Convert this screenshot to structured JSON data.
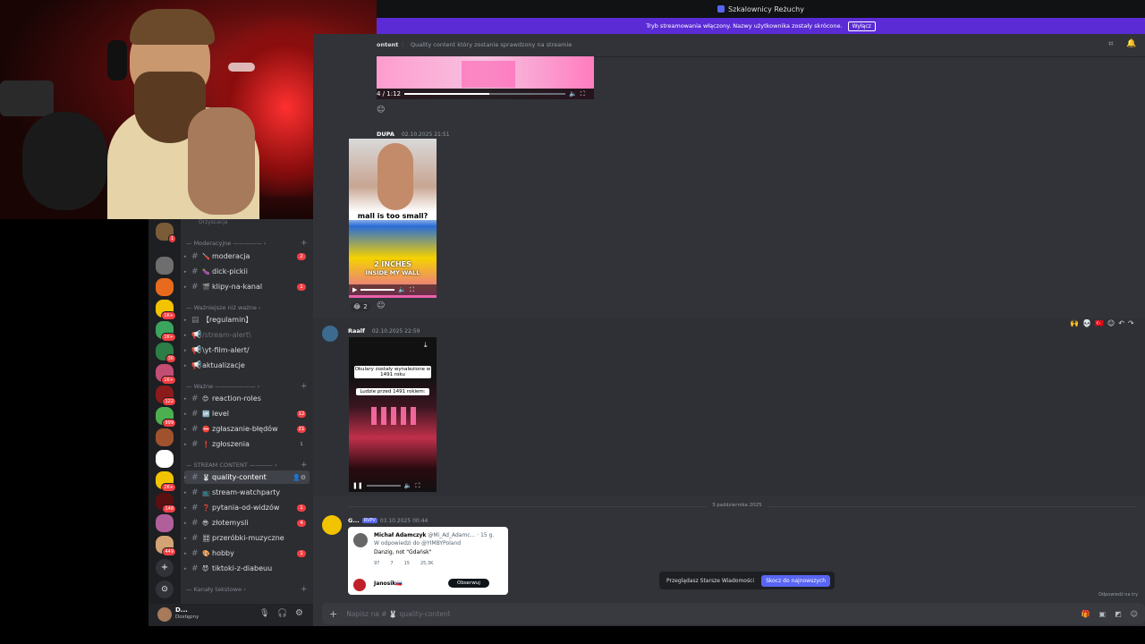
{
  "window": {
    "title": "Szkalownicy Reżuchy"
  },
  "banner": {
    "text": "Tryb streamowania włączony. Nazwy użytkownika zostały skrócone.",
    "button": "Wyłącz"
  },
  "chathead": {
    "channel_partial": "ontent",
    "topic": "Quality content który zostanie sprawdzony na streamie"
  },
  "sidebar": {
    "hidden_top_label": "Drzyscacja",
    "categories": [
      {
        "label": "Moderacyjne"
      },
      {
        "label": "Ważniejsze niż ważne"
      },
      {
        "label": "Ważne"
      },
      {
        "label": "STREAM CONTENT"
      },
      {
        "label": "Kanały tekstowe"
      }
    ],
    "channels": [
      {
        "name": "moderacja",
        "emoji": "🪛",
        "badge": "2"
      },
      {
        "name": "dick-pickii",
        "emoji": "🍆",
        "badge": ""
      },
      {
        "name": "klipy-na-kanal",
        "emoji": "🎬",
        "badge": "1"
      },
      {
        "name": "【regulamin】",
        "emoji": "",
        "badge": ""
      },
      {
        "name": "/stream-alert\\",
        "emoji": "",
        "badge": ""
      },
      {
        "name": "\\yt-film-alert/",
        "emoji": "",
        "badge": ""
      },
      {
        "name": "aktualizacje",
        "emoji": "",
        "badge": ""
      },
      {
        "name": "reaction-roles",
        "emoji": "😊",
        "badge": ""
      },
      {
        "name": "level",
        "emoji": "🆙",
        "badge": "12"
      },
      {
        "name": "zgłaszanie-błędów",
        "emoji": "⛔",
        "badge": "21"
      },
      {
        "name": "zgłoszenia",
        "emoji": "❗",
        "badge": "1"
      },
      {
        "name": "quality-content",
        "emoji": "🐰",
        "badge": ""
      },
      {
        "name": "stream-watchparty",
        "emoji": "📺",
        "badge": ""
      },
      {
        "name": "pytania-od-widzów",
        "emoji": "❓",
        "badge": "1"
      },
      {
        "name": "złotemysli",
        "emoji": "😎",
        "badge": "4"
      },
      {
        "name": "przeróbki-muzyczne",
        "emoji": "🎛",
        "badge": ""
      },
      {
        "name": "hobby",
        "emoji": "🎨",
        "badge": "1"
      },
      {
        "name": "tiktoki-z-diabeuu",
        "emoji": "😈",
        "badge": ""
      }
    ],
    "server_badges": [
      "1",
      "1",
      "1K+",
      "1K+",
      "36",
      "1K+",
      "122",
      "999",
      "2K+",
      "148",
      "449"
    ]
  },
  "user": {
    "name": "D...",
    "status": "Dostępny"
  },
  "messages": [
    {
      "video_time": "4 / 1:12"
    },
    {
      "author": "DUPA",
      "time": "02.10.2025 21:51",
      "video_caption1": "mall is too small?",
      "video_caption2": "2 INCHES",
      "video_caption3": "INSIDE MY WALL",
      "reaction_count": "2"
    },
    {
      "author": "Raalf",
      "time": "02.10.2025 22:59",
      "caption1": "Okulary zostały wynalezione w 1491 roku",
      "caption2": "Ludzie przed 1491 rokiem:"
    },
    {
      "author": "G...",
      "tag": "RVPV",
      "time": "03.10.2025 00:44",
      "tweet_author": "Michał Adamczyk",
      "tweet_handle": "@Mi_Ad_Adamc...",
      "tweet_age": "· 15 g.",
      "tweet_reply": "W odpowiedzi do @YIMBYPoland",
      "tweet_text": "Danzig, not \"Gdańsk\"",
      "tweet_stats": [
        "97",
        "7",
        "15",
        "25,3K"
      ],
      "follower": "Janosik🇸🇰",
      "follow_btn": "Obserwuj"
    }
  ],
  "divider": "3 października 2025",
  "jump": {
    "text": "Przeglądasz Starsze Wiadomości",
    "button": "Skocz do najnowszych"
  },
  "composer": {
    "placeholder": "Napisz na # 🐰 quality-content"
  },
  "misc": {
    "reply_hint": "Odpowiedź na try"
  }
}
